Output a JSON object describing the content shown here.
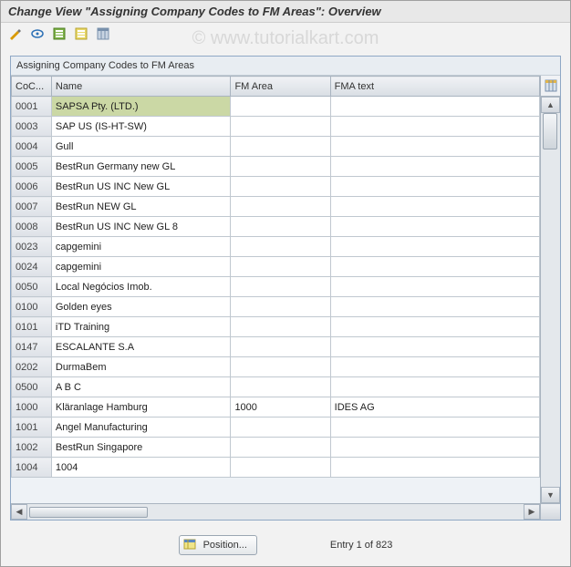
{
  "title": "Change View \"Assigning Company Codes to FM Areas\": Overview",
  "watermark": "© www.tutorialkart.com",
  "table": {
    "title": "Assigning Company Codes to FM Areas",
    "columns": {
      "cocode": "CoC...",
      "name": "Name",
      "fmarea": "FM Area",
      "fmatext": "FMA text"
    },
    "rows": [
      {
        "co": "0001",
        "name": "SAPSA Pty. (LTD.)",
        "fm": "",
        "txt": "",
        "selected": true
      },
      {
        "co": "0003",
        "name": "SAP US (IS-HT-SW)",
        "fm": "",
        "txt": ""
      },
      {
        "co": "0004",
        "name": "Gull",
        "fm": "",
        "txt": ""
      },
      {
        "co": "0005",
        "name": "BestRun Germany new GL",
        "fm": "",
        "txt": ""
      },
      {
        "co": "0006",
        "name": "BestRun US INC New GL",
        "fm": "",
        "txt": ""
      },
      {
        "co": "0007",
        "name": "BestRun NEW GL",
        "fm": "",
        "txt": ""
      },
      {
        "co": "0008",
        "name": "BestRun US INC New GL 8",
        "fm": "",
        "txt": ""
      },
      {
        "co": "0023",
        "name": "capgemini",
        "fm": "",
        "txt": ""
      },
      {
        "co": "0024",
        "name": "capgemini",
        "fm": "",
        "txt": ""
      },
      {
        "co": "0050",
        "name": "Local Negócios Imob.",
        "fm": "",
        "txt": ""
      },
      {
        "co": "0100",
        "name": "Golden eyes",
        "fm": "",
        "txt": ""
      },
      {
        "co": "0101",
        "name": "iTD Training",
        "fm": "",
        "txt": ""
      },
      {
        "co": "0147",
        "name": "ESCALANTE S.A",
        "fm": "",
        "txt": ""
      },
      {
        "co": "0202",
        "name": "DurmaBem",
        "fm": "",
        "txt": ""
      },
      {
        "co": "0500",
        "name": "A B C",
        "fm": "",
        "txt": ""
      },
      {
        "co": "1000",
        "name": "Kläranlage Hamburg",
        "fm": "1000",
        "txt": "IDES AG"
      },
      {
        "co": "1001",
        "name": "Angel Manufacturing",
        "fm": "",
        "txt": ""
      },
      {
        "co": "1002",
        "name": "BestRun Singapore",
        "fm": "",
        "txt": ""
      },
      {
        "co": "1004",
        "name": "1004",
        "fm": "",
        "txt": ""
      }
    ]
  },
  "footer": {
    "position_label": "Position...",
    "entry_text": "Entry 1 of 823"
  }
}
